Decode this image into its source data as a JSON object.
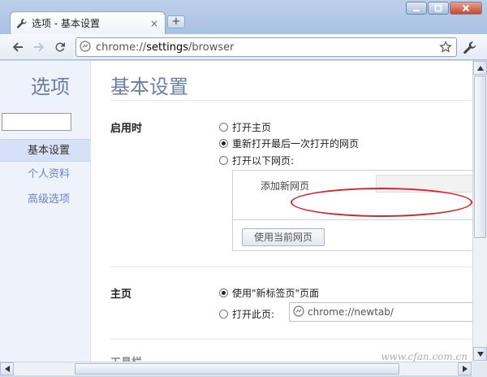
{
  "window": {
    "tab_title": "选项 - 基本设置",
    "new_tab_label": "+",
    "close_tab_label": "×"
  },
  "toolbar": {
    "url_scheme": "chrome://",
    "url_host": "settings",
    "url_path": "/browser"
  },
  "sidebar": {
    "heading": "选项",
    "search_placeholder": "",
    "items": [
      {
        "label": "基本设置",
        "active": true
      },
      {
        "label": "个人资料",
        "active": false
      },
      {
        "label": "高级选项",
        "active": false
      }
    ]
  },
  "main": {
    "title": "基本设置",
    "startup": {
      "label": "启用时",
      "options": [
        {
          "label": "打开主页",
          "selected": false
        },
        {
          "label": "重新打开最后一次打开的网页",
          "selected": true
        },
        {
          "label": "打开以下网页:",
          "selected": false
        }
      ],
      "add_page_label": "添加新网页",
      "use_current_button": "使用当前网页"
    },
    "homepage": {
      "label": "主页",
      "options": [
        {
          "label": "使用\"新标签页\"页面",
          "selected": true
        },
        {
          "label": "打开此页:",
          "selected": false
        }
      ],
      "url_value": "chrome://newtab/"
    },
    "next_section_label": "工具栏"
  },
  "watermark": "www.cfan.com.cn",
  "colors": {
    "accent": "#6a7fa3",
    "highlight_ring": "#d6242b",
    "sidebar_bg": "#eef2fb"
  }
}
